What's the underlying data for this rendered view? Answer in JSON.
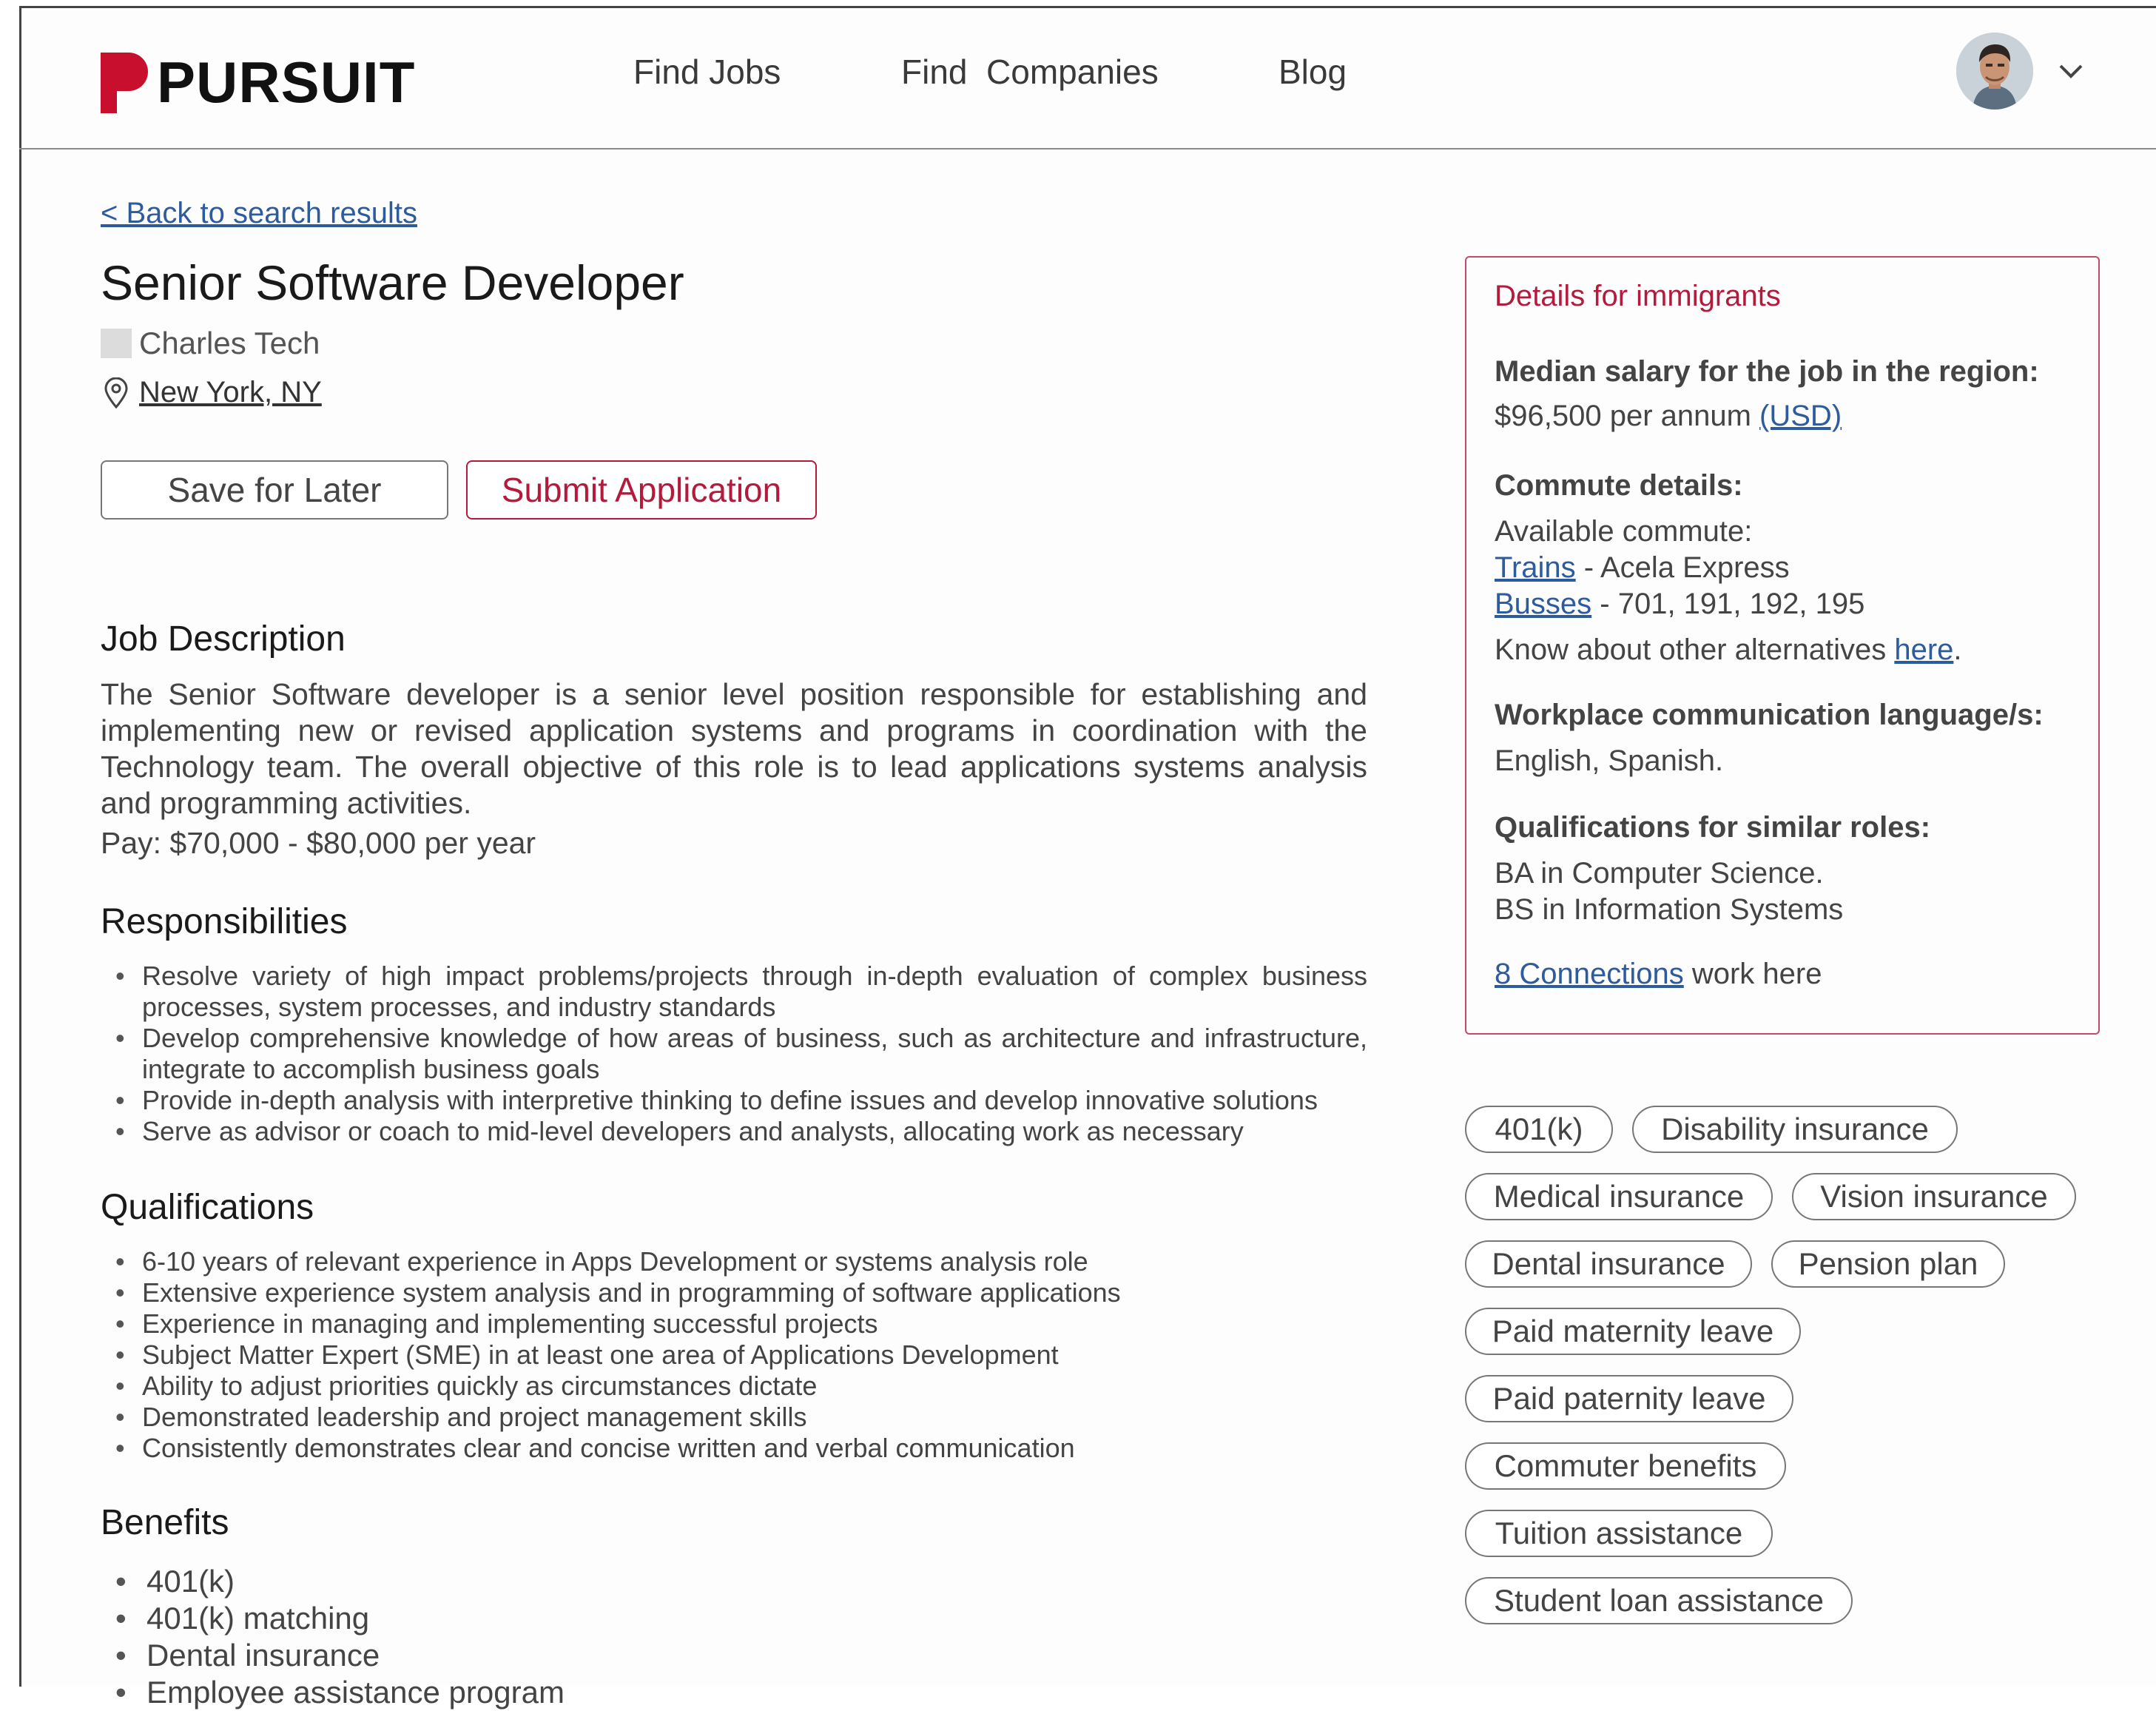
{
  "header": {
    "logo_text": "PURSUIT",
    "nav": [
      "Find Jobs",
      "Find  Companies",
      "Blog"
    ],
    "brand_color": "#c8102e"
  },
  "job": {
    "back_link": "< Back to search results",
    "title": "Senior Software Developer",
    "company": "Charles Tech",
    "location": "New York, NY",
    "save_label": "Save for Later",
    "submit_label": "Submit Application"
  },
  "description": {
    "heading": "Job Description",
    "text": "The Senior Software developer is a senior level position responsible for establishing and implementing new or revised application systems and programs in coordination with the Technology team. The overall objective of this role is to lead applications systems analysis and programming activities.",
    "pay": "Pay: $70,000 - $80,000 per year"
  },
  "responsibilities": {
    "heading": "Responsibilities",
    "items": [
      "Resolve variety of high impact problems/projects through in-depth evaluation of complex business processes, system processes, and industry standards",
      "Develop comprehensive knowledge of how areas of business, such as architecture and infrastructure, integrate to accomplish business goals",
      "Provide in-depth analysis with interpretive thinking to define issues and develop innovative solutions",
      "Serve as advisor or coach to mid-level developers and analysts, allocating work as necessary"
    ]
  },
  "qualifications": {
    "heading": "Qualifications",
    "items": [
      "6-10 years of relevant experience in Apps Development or systems analysis role",
      "Extensive experience system analysis and in programming of software applications",
      "Experience in managing and implementing successful projects",
      "Subject Matter Expert (SME) in at least one area of Applications Development",
      "Ability to adjust priorities quickly as circumstances dictate",
      "Demonstrated leadership and project management skills",
      "Consistently demonstrates clear and concise written and verbal communication"
    ]
  },
  "benefits": {
    "heading": "Benefits",
    "items": [
      "401(k)",
      "401(k) matching",
      "Dental insurance",
      "Employee assistance program"
    ]
  },
  "immigrants": {
    "title": "Details for immigrants",
    "salary_label": "Median salary for the job in the region:",
    "salary_value": "$96,500 per annum ",
    "salary_currency": "(USD)",
    "commute_label": "Commute details:",
    "commute_available": "Available commute:",
    "trains_link": "Trains",
    "trains_text": " - Acela Express",
    "busses_link": "Busses",
    "busses_text": " - 701, 191, 192, 195",
    "alternatives_text": "Know about other alternatives ",
    "alternatives_link": "here",
    "alternatives_end": ".",
    "language_label": "Workplace communication language/s:",
    "language_value": "English, Spanish.",
    "qual_label": "Qualifications for similar roles:",
    "qual_1": "BA in Computer Science.",
    "qual_2": "BS in Information Systems",
    "connections_link": "8 Connections",
    "connections_text": " work here"
  },
  "chips": [
    "401(k)",
    "Disability insurance",
    "Medical insurance",
    "Vision insurance",
    "Dental insurance",
    "Pension plan",
    "Paid maternity leave",
    "Paid paternity leave",
    "Commuter benefits",
    "Tuition assistance",
    "Student loan assistance"
  ]
}
